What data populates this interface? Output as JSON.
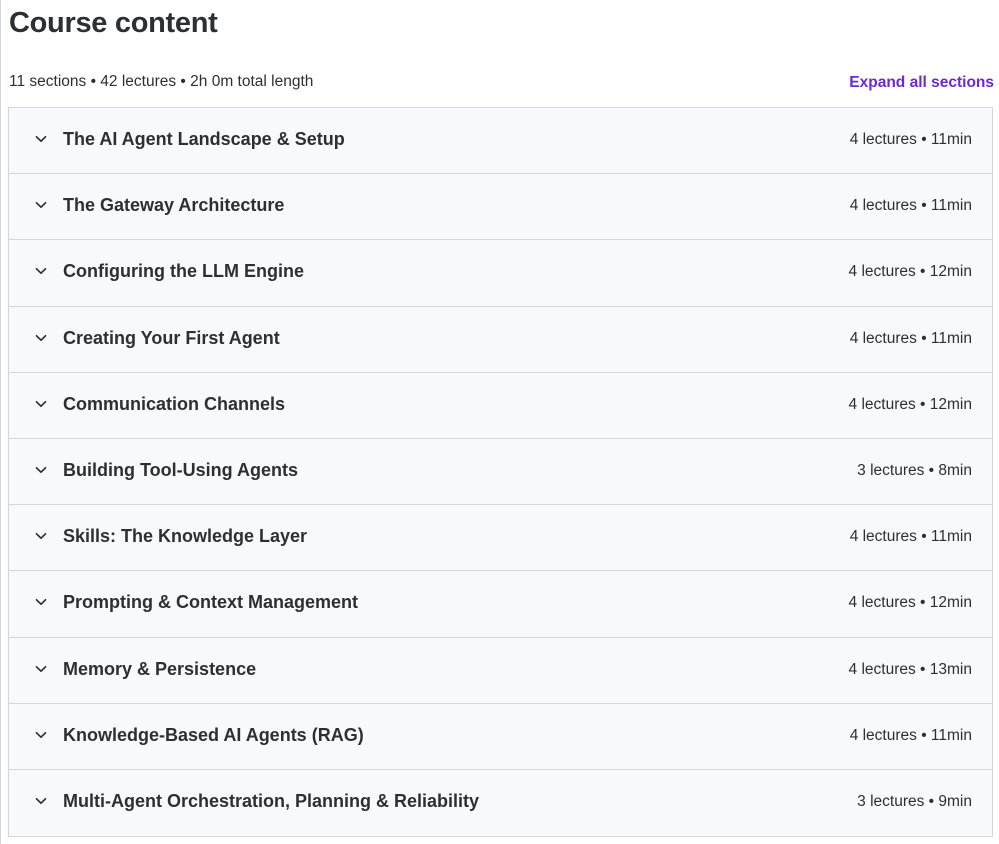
{
  "header": {
    "title": "Course content",
    "summary": "11 sections • 42 lectures • 2h 0m total length",
    "expand_label": "Expand all sections"
  },
  "colors": {
    "accent": "#6d28d2",
    "text": "#2d2f31",
    "section_bg": "#f7f9fa",
    "border": "#d1d7dc"
  },
  "sections": [
    {
      "title": "The AI Agent Landscape & Setup",
      "meta": "4 lectures • 11min",
      "icon": "chevron-down-icon"
    },
    {
      "title": "The Gateway Architecture",
      "meta": "4 lectures • 11min",
      "icon": "chevron-down-icon"
    },
    {
      "title": "Configuring the LLM Engine",
      "meta": "4 lectures • 12min",
      "icon": "chevron-down-icon"
    },
    {
      "title": "Creating Your First Agent",
      "meta": "4 lectures • 11min",
      "icon": "chevron-down-icon"
    },
    {
      "title": "Communication Channels",
      "meta": "4 lectures • 12min",
      "icon": "chevron-down-icon"
    },
    {
      "title": "Building Tool-Using Agents",
      "meta": "3 lectures • 8min",
      "icon": "chevron-down-icon"
    },
    {
      "title": "Skills: The Knowledge Layer",
      "meta": "4 lectures • 11min",
      "icon": "chevron-down-icon"
    },
    {
      "title": "Prompting & Context Management",
      "meta": "4 lectures • 12min",
      "icon": "chevron-down-icon"
    },
    {
      "title": "Memory & Persistence",
      "meta": "4 lectures • 13min",
      "icon": "chevron-down-icon"
    },
    {
      "title": "Knowledge-Based AI Agents (RAG)",
      "meta": "4 lectures • 11min",
      "icon": "chevron-down-icon"
    },
    {
      "title": "Multi-Agent Orchestration, Planning & Reliability",
      "meta": "3 lectures • 9min",
      "icon": "chevron-down-icon"
    }
  ]
}
